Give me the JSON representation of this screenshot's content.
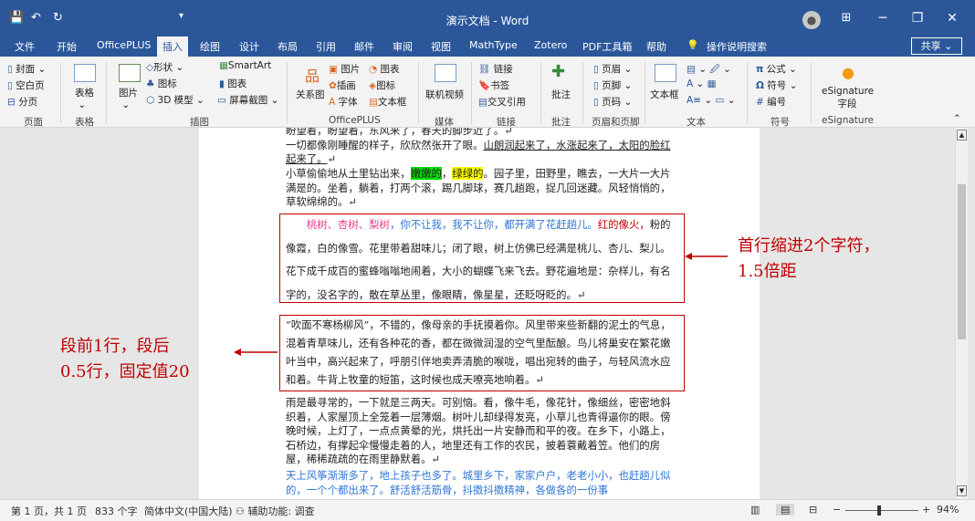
{
  "app": {
    "title": "演示文档 - Word"
  },
  "quick_access": [
    "💾",
    "↶",
    "↻",
    "▾"
  ],
  "window": {
    "minimize": "─",
    "restore": "❐",
    "close": "✕",
    "layout_icon": "⊞"
  },
  "tabs": [
    "文件",
    "开始",
    "OfficePLUS",
    "插入",
    "绘图",
    "设计",
    "布局",
    "引用",
    "邮件",
    "审阅",
    "视图",
    "MathType",
    "Zotero",
    "PDF工具箱",
    "帮助"
  ],
  "search": "操作说明搜索",
  "share": "共享",
  "ribbon": {
    "pages": {
      "cover": "封面",
      "blank": "空白页",
      "break": "分页",
      "label": "页面"
    },
    "tables": {
      "table": "表格",
      "label": "表格"
    },
    "illustrations": {
      "picture": "图片",
      "shapes": "形状",
      "icons": "图标",
      "models": "3D 模型",
      "smartart": "SmartArt",
      "chart": "图表",
      "screenshot": "屏幕截图",
      "label": "插图"
    },
    "officeplus": {
      "relation": "关系图",
      "picture": "图片",
      "chart": "图表",
      "illustration": "插画",
      "icon": "图标",
      "font": "字体",
      "textbox": "文本框",
      "label": "OfficePLUS"
    },
    "media": {
      "online_video": "联机视频",
      "label": "媒体"
    },
    "links": {
      "link": "链接",
      "bookmark": "书签",
      "crossref": "交叉引用",
      "label": "链接"
    },
    "comments": {
      "comment": "批注",
      "label": "批注"
    },
    "header_footer": {
      "header": "页眉",
      "footer": "页脚",
      "page_number": "页码",
      "label": "页眉和页脚"
    },
    "text": {
      "textbox": "文本框",
      "label": "文本"
    },
    "symbols": {
      "equation": "公式",
      "symbol": "符号",
      "number": "编号",
      "label": "符号"
    },
    "esign": {
      "field": "eSignature 字段",
      "label": "eSignature"
    }
  },
  "doc": {
    "p0": "盼望着，盼望着，东风来了，春天的脚步近了。↵",
    "p1": "一切都像刚睡醒的样子，欣欣然张开了眼。山朗润起来了，水涨起来了，太阳的脸红起来了。↵",
    "p2a": "小草偷偷地从土里钻出来，",
    "p2b": "嫩嫩的",
    "p2c": "，",
    "p2d": "绿绿的",
    "p2e": "。园子里，田野里，瞧去，一大片一大片满是的。坐着，躺着，打两个滚，踢几脚球，赛几趟跑，捉几回迷藏。风轻悄悄的，草软绵绵的。↵",
    "p3a": "桃树、杏树、梨树",
    "p3b": "，你不让我，我不让你，都开满了花赶趟儿。",
    "p3c": "红的像火，",
    "p3d": "粉的像霞，白的像雪。花里带着甜味儿；闭了眼，树上仿佛已经满是桃儿、杏儿、梨儿。花下成千成百的蜜蜂嗡嗡地闹着，大小的蝴蝶飞来飞去。野花遍地是：杂样儿，有名字的，没名字的，散在草丛里，像眼睛，像星星，还眨呀眨的。↵",
    "p4": "“吹面不寒杨柳风”，不错的，像母亲的手抚摸着你。风里带来些新翻的泥土的气息，混着青草味儿，还有各种花的香，都在微微润湿的空气里酝酿。鸟儿将巢安在繁花嫩叶当中，高兴起来了，呼朋引伴地卖弄清脆的喉咙，唱出宛转的曲子，与轻风流水应和着。牛背上牧童的短笛，这时候也成天嘹亮地响着。↵",
    "p5": "雨是最寻常的，一下就是三两天。可别恼。看，像牛毛，像花针，像细丝，密密地斜织着，人家屋顶上全笼着一层薄烟。树叶儿却绿得发亮，小草儿也青得逼你的眼。傍晚时候，上灯了，一点点黄晕的光，烘托出一片安静而和平的夜。在乡下，小路上，石桥边，有撑起伞慢慢走着的人，地里还有工作的农民，披着蓑戴着笠。他们的房屋，稀稀疏疏的在雨里静默着。↵",
    "p6": "天上风筝渐渐多了，地上孩子也多了。城里乡下，家家户户，老老小小，也赶趟儿似的，一个个都出来了。舒活舒活筋骨，抖擞抖擞精神，各做各的一份事"
  },
  "annotations": {
    "right1": "首行缩进2个字符，",
    "right2": "1.5倍距",
    "left1": "段前1行，段后",
    "left2": "0.5行，固定值20"
  },
  "status": {
    "page": "第 1 页，共 1 页",
    "words": "833 个字",
    "lang": "简体中文(中国大陆)",
    "access": "辅助功能: 调查",
    "zoom": "94%"
  },
  "colors": {
    "accent": "#2b579a",
    "red": "#c00000",
    "pink": "#e83e8c",
    "blue": "#2e75d6",
    "green": "#00e000",
    "yellow": "#ffff00"
  }
}
